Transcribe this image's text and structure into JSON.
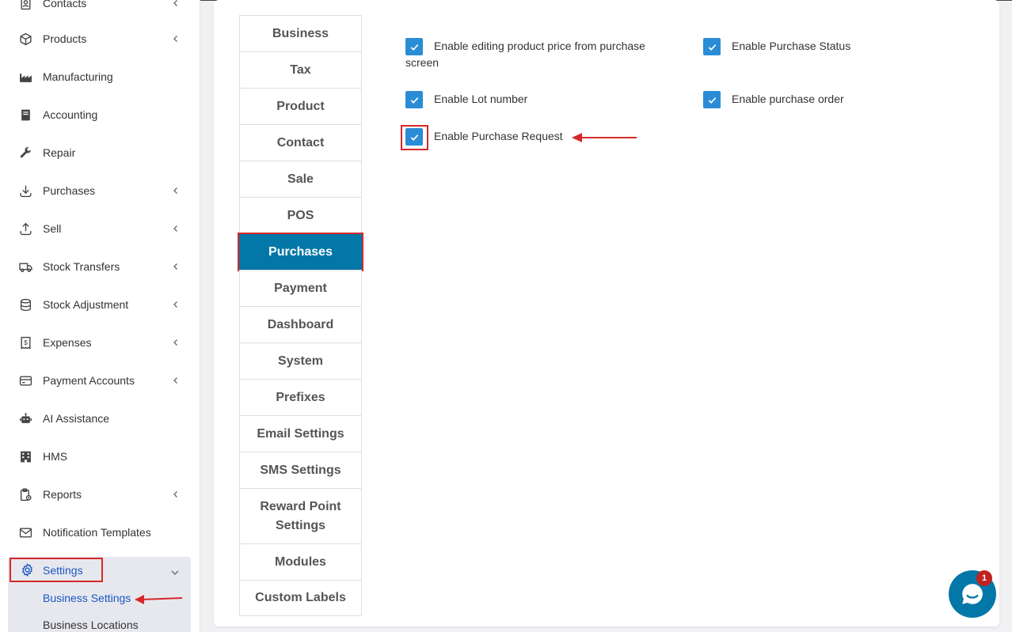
{
  "sidebar": {
    "items": [
      {
        "label": "Contacts",
        "icon": "contacts-icon",
        "chevron": true
      },
      {
        "label": "Products",
        "icon": "cube-icon",
        "chevron": true
      },
      {
        "label": "Manufacturing",
        "icon": "factory-icon",
        "chevron": false
      },
      {
        "label": "Accounting",
        "icon": "book-icon",
        "chevron": false
      },
      {
        "label": "Repair",
        "icon": "wrench-icon",
        "chevron": false
      },
      {
        "label": "Purchases",
        "icon": "download-icon",
        "chevron": true
      },
      {
        "label": "Sell",
        "icon": "upload-icon",
        "chevron": true
      },
      {
        "label": "Stock Transfers",
        "icon": "truck-icon",
        "chevron": true
      },
      {
        "label": "Stock Adjustment",
        "icon": "database-icon",
        "chevron": true
      },
      {
        "label": "Expenses",
        "icon": "receipt-dollar-icon",
        "chevron": true
      },
      {
        "label": "Payment Accounts",
        "icon": "credit-card-icon",
        "chevron": true
      },
      {
        "label": "AI Assistance",
        "icon": "robot-icon",
        "chevron": false
      },
      {
        "label": "HMS",
        "icon": "building-icon",
        "chevron": false
      },
      {
        "label": "Reports",
        "icon": "clipboard-report-icon",
        "chevron": true
      },
      {
        "label": "Notification Templates",
        "icon": "envelope-icon",
        "chevron": false
      }
    ],
    "settings": {
      "label": "Settings",
      "icon": "gear-icon"
    },
    "sub_items": {
      "business_settings": "Business Settings",
      "business_locations": "Business Locations"
    }
  },
  "tabs": [
    {
      "label": "Business"
    },
    {
      "label": "Tax"
    },
    {
      "label": "Product"
    },
    {
      "label": "Contact"
    },
    {
      "label": "Sale"
    },
    {
      "label": "POS"
    },
    {
      "label": "Purchases",
      "active": true
    },
    {
      "label": "Payment"
    },
    {
      "label": "Dashboard"
    },
    {
      "label": "System"
    },
    {
      "label": "Prefixes"
    },
    {
      "label": "Email Settings"
    },
    {
      "label": "SMS Settings"
    },
    {
      "label": "Reward Point Settings"
    },
    {
      "label": "Modules"
    },
    {
      "label": "Custom Labels"
    }
  ],
  "options": {
    "edit_price": {
      "label": "Enable editing product price from purchase screen",
      "checked": true
    },
    "purchase_status": {
      "label": "Enable Purchase Status",
      "checked": true
    },
    "lot_number": {
      "label": "Enable Lot number",
      "checked": true
    },
    "purchase_order": {
      "label": "Enable purchase order",
      "checked": true
    },
    "purchase_request": {
      "label": "Enable Purchase Request",
      "checked": true
    }
  },
  "chat": {
    "badge": "1"
  },
  "colors": {
    "accent": "#0377a8",
    "checkbox": "#2b8cd6",
    "highlight": "#d62828",
    "link": "#1b56c5"
  }
}
